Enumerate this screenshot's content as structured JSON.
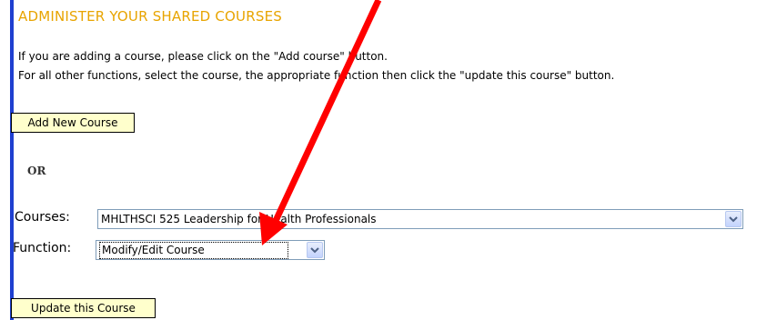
{
  "page": {
    "heading": "ADMINISTER YOUR SHARED COURSES",
    "instruction_1": "If you are adding a course, please click on the \"Add course\" button.",
    "instruction_2": "For all other functions, select the course, the appropriate function then click the \"update this course\" button."
  },
  "buttons": {
    "add_course": "Add New Course",
    "update_course": "Update this Course"
  },
  "or_label": "OR",
  "courses": {
    "label": "Courses:",
    "selected": "MHLTHSCI 525 Leadership for Health Professionals"
  },
  "function": {
    "label": "Function:",
    "selected": "Modify/Edit Course"
  },
  "colors": {
    "heading": "#e8a400",
    "left_rule": "#1f3fd0",
    "button_bg": "#ffffcc",
    "annotation_arrow": "#ff0000"
  },
  "icons": {
    "dropdown": "chevron-down-icon",
    "annotation": "red-arrow-annotation"
  }
}
